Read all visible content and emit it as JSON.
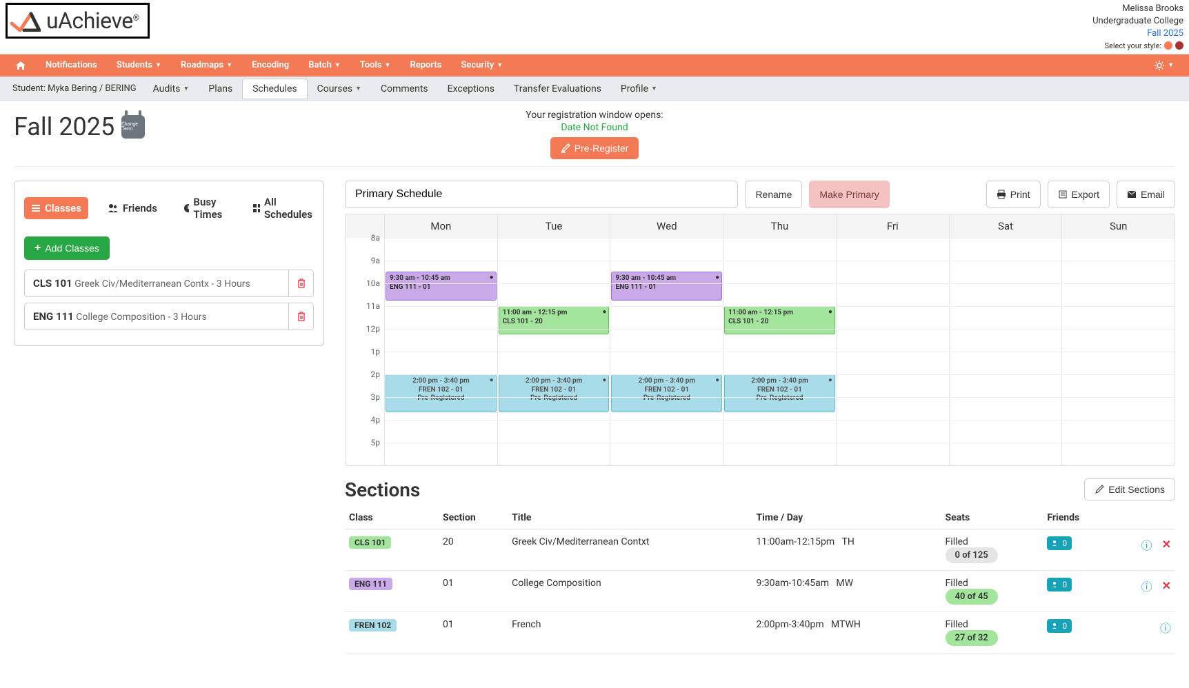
{
  "app": {
    "name": "uAchieve"
  },
  "user": {
    "name": "Melissa Brooks",
    "college": "Undergraduate College",
    "term": "Fall 2025",
    "style_label": "Select your style:"
  },
  "nav1": {
    "items": [
      "Notifications",
      "Students",
      "Roadmaps",
      "Encoding",
      "Batch",
      "Tools",
      "Reports",
      "Security"
    ],
    "dropdowns": [
      false,
      true,
      true,
      false,
      true,
      true,
      false,
      true
    ]
  },
  "nav2": {
    "student_label": "Student: Myka Bering / BERING",
    "items": [
      "Audits",
      "Plans",
      "Schedules",
      "Courses",
      "Comments",
      "Exceptions",
      "Transfer Evaluations",
      "Profile"
    ],
    "dropdowns": [
      true,
      false,
      false,
      true,
      false,
      false,
      false,
      true
    ],
    "active": "Schedules"
  },
  "term": {
    "title": "Fall 2025",
    "change_label": "Change Term"
  },
  "registration": {
    "line1": "Your registration window opens:",
    "line2": "Date Not Found",
    "button": "Pre-Register"
  },
  "left_tabs": {
    "classes": "Classes",
    "friends": "Friends",
    "busy": "Busy Times",
    "all": "All Schedules"
  },
  "add_classes_btn": "Add Classes",
  "classes": [
    {
      "code": "CLS 101",
      "desc": "Greek Civ/Mediterranean Contx - 3 Hours"
    },
    {
      "code": "ENG 111",
      "desc": "College Composition - 3 Hours"
    }
  ],
  "schedule": {
    "name": "Primary Schedule",
    "rename": "Rename",
    "make_primary": "Make Primary",
    "print": "Print",
    "export": "Export",
    "email": "Email"
  },
  "calendar": {
    "days": [
      "Mon",
      "Tue",
      "Wed",
      "Thu",
      "Fri",
      "Sat",
      "Sun"
    ],
    "hours": [
      "8a",
      "9a",
      "10a",
      "11a",
      "12p",
      "1p",
      "2p",
      "3p",
      "4p",
      "5p"
    ],
    "events": [
      {
        "day": 0,
        "top_pct": 15.0,
        "height_pct": 12.5,
        "cls": "ev-purple",
        "time": "9:30 am - 10:45 am",
        "title": "ENG 111 - 01"
      },
      {
        "day": 2,
        "top_pct": 15.0,
        "height_pct": 12.5,
        "cls": "ev-purple",
        "time": "9:30 am - 10:45 am",
        "title": "ENG 111 - 01"
      },
      {
        "day": 1,
        "top_pct": 30.0,
        "height_pct": 12.5,
        "cls": "ev-green",
        "time": "11:00 am - 12:15 pm",
        "title": "CLS 101 - 20"
      },
      {
        "day": 3,
        "top_pct": 30.0,
        "height_pct": 12.5,
        "cls": "ev-green",
        "time": "11:00 am - 12:15 pm",
        "title": "CLS 101 - 20"
      },
      {
        "day": 0,
        "top_pct": 60.0,
        "height_pct": 16.7,
        "cls": "ev-blue",
        "time": "2:00 pm - 3:40 pm",
        "title": "FREN 102 - 01",
        "status": "Pre-Registered"
      },
      {
        "day": 1,
        "top_pct": 60.0,
        "height_pct": 16.7,
        "cls": "ev-blue",
        "time": "2:00 pm - 3:40 pm",
        "title": "FREN 102 - 01",
        "status": "Pre-Registered"
      },
      {
        "day": 2,
        "top_pct": 60.0,
        "height_pct": 16.7,
        "cls": "ev-blue",
        "time": "2:00 pm - 3:40 pm",
        "title": "FREN 102 - 01",
        "status": "Pre-Registered"
      },
      {
        "day": 3,
        "top_pct": 60.0,
        "height_pct": 16.7,
        "cls": "ev-blue",
        "time": "2:00 pm - 3:40 pm",
        "title": "FREN 102 - 01",
        "status": "Pre-Registered"
      }
    ]
  },
  "sections": {
    "title": "Sections",
    "edit": "Edit Sections",
    "headers": {
      "class": "Class",
      "section": "Section",
      "title": "Title",
      "time": "Time / Day",
      "seats": "Seats",
      "friends": "Friends"
    },
    "rows": [
      {
        "class": "CLS 101",
        "badge": "b-green",
        "section": "20",
        "title": "Greek Civ/Mediterranean Contxt",
        "time": "11:00am-12:15pm",
        "days": "TH",
        "seats_label": "Filled",
        "seats": "0 of 125",
        "pill": "p-gray",
        "deletable": true
      },
      {
        "class": "ENG 111",
        "badge": "b-purple",
        "section": "01",
        "title": "College Composition",
        "time": "9:30am-10:45am",
        "days": "MW",
        "seats_label": "Filled",
        "seats": "40 of 45",
        "pill": "p-green",
        "deletable": true
      },
      {
        "class": "FREN 102",
        "badge": "b-blue",
        "section": "01",
        "title": "French",
        "time": "2:00pm-3:40pm",
        "days": "MTWH",
        "seats_label": "Filled",
        "seats": "27 of 32",
        "pill": "p-green",
        "deletable": false
      }
    ]
  }
}
